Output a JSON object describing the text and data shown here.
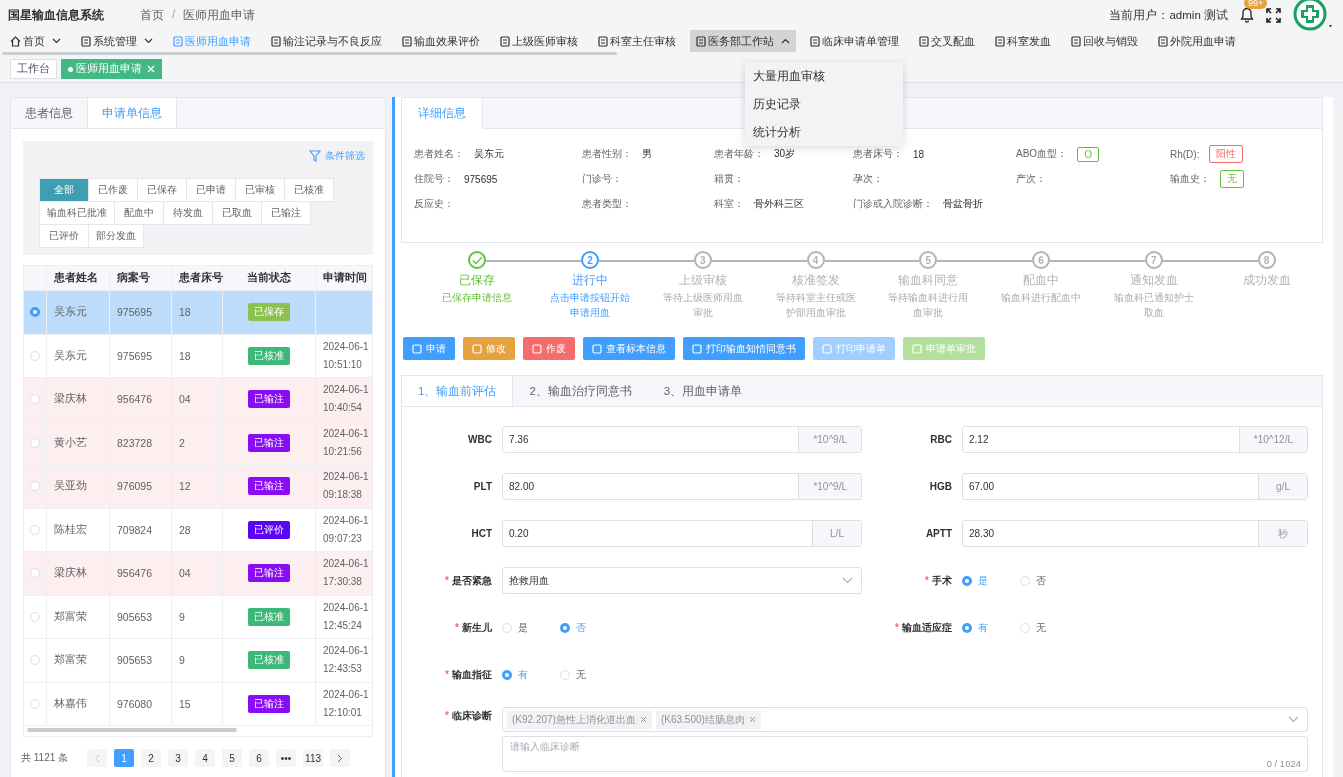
{
  "app": {
    "title": "国星输血信息系统"
  },
  "breadcrumb": {
    "items": [
      "首页",
      "医师用血申请"
    ],
    "separator": "/"
  },
  "user": {
    "label": "当前用户：admin 测试",
    "badge": "99+"
  },
  "nav": [
    {
      "label": "首页",
      "caret": true,
      "selected": false,
      "expanded": false
    },
    {
      "label": "系统管理",
      "caret": true,
      "selected": false,
      "expanded": false
    },
    {
      "label": "医师用血申请",
      "caret": false,
      "selected": true,
      "expanded": false
    },
    {
      "label": "输注记录与不良反应",
      "caret": false,
      "selected": false,
      "expanded": false
    },
    {
      "label": "输血效果评价",
      "caret": false,
      "selected": false,
      "expanded": false
    },
    {
      "label": "上级医师审核",
      "caret": false,
      "selected": false,
      "expanded": false
    },
    {
      "label": "科室主任审核",
      "caret": false,
      "selected": false,
      "expanded": false
    },
    {
      "label": "医务部工作站",
      "caret": true,
      "selected": false,
      "expanded": true
    },
    {
      "label": "临床申请单管理",
      "caret": false,
      "selected": false,
      "expanded": false
    },
    {
      "label": "交叉配血",
      "caret": false,
      "selected": false,
      "expanded": false
    },
    {
      "label": "科室发血",
      "caret": false,
      "selected": false,
      "expanded": false
    },
    {
      "label": "回收与销毁",
      "caret": false,
      "selected": false,
      "expanded": false
    },
    {
      "label": "外院用血申请",
      "caret": false,
      "selected": false,
      "expanded": false
    }
  ],
  "dropdown": [
    "大量用血审核",
    "历史记录",
    "统计分析"
  ],
  "page_tabs": [
    {
      "label": "工作台",
      "selected": false
    },
    {
      "label": "医师用血申请",
      "selected": true
    }
  ],
  "left": {
    "tabs": [
      {
        "label": "患者信息",
        "selected": false
      },
      {
        "label": "申请单信息",
        "selected": true
      }
    ],
    "filter_link": "条件筛选",
    "filters": [
      {
        "label": "全部",
        "selected": true
      },
      {
        "label": "已作废",
        "selected": false
      },
      {
        "label": "已保存",
        "selected": false
      },
      {
        "label": "已申请",
        "selected": false
      },
      {
        "label": "已审核",
        "selected": false
      },
      {
        "label": "已核准",
        "selected": false
      },
      {
        "label": "输血科已批准",
        "selected": false
      },
      {
        "label": "配血中",
        "selected": false
      },
      {
        "label": "待发血",
        "selected": false
      },
      {
        "label": "已取血",
        "selected": false
      },
      {
        "label": "已输注",
        "selected": false
      },
      {
        "label": "已评价",
        "selected": false
      },
      {
        "label": "部分发血",
        "selected": false
      }
    ],
    "columns": [
      "患者姓名",
      "病案号",
      "患者床号",
      "当前状态",
      "申请时间"
    ],
    "rows": [
      {
        "selected": true,
        "flagged": false,
        "name": "吴东元",
        "case_no": "975695",
        "bed": "18",
        "status": "已保存",
        "color": "#8cc152"
      },
      {
        "selected": false,
        "flagged": false,
        "name": "吴东元",
        "case_no": "975695",
        "bed": "18",
        "status": "已核准",
        "color": "#3cb878",
        "date": "2024-06-1",
        "time": "10:51:10"
      },
      {
        "selected": false,
        "flagged": true,
        "name": "梁庆林",
        "case_no": "956476",
        "bed": "04",
        "status": "已输注",
        "color": "#8a0cf5",
        "date": "2024-06-1",
        "time": "10:40:54"
      },
      {
        "selected": false,
        "flagged": true,
        "name": "黄小艺",
        "case_no": "823728",
        "bed": "2",
        "status": "已输注",
        "color": "#8a0cf5",
        "date": "2024-06-1",
        "time": "10:21:56"
      },
      {
        "selected": false,
        "flagged": true,
        "name": "吴亚劲",
        "case_no": "976095",
        "bed": "12",
        "status": "已输注",
        "color": "#8a0cf5",
        "date": "2024-06-1",
        "time": "09:18:38"
      },
      {
        "selected": false,
        "flagged": false,
        "name": "陈桂宏",
        "case_no": "709824",
        "bed": "28",
        "status": "已评价",
        "color": "#5a06f0",
        "date": "2024-06-1",
        "time": "09:07:23"
      },
      {
        "selected": false,
        "flagged": true,
        "name": "梁庆林",
        "case_no": "956476",
        "bed": "04",
        "status": "已输注",
        "color": "#8a0cf5",
        "date": "2024-06-1",
        "time": "17:30:38"
      },
      {
        "selected": false,
        "flagged": false,
        "name": "郑富荣",
        "case_no": "905653",
        "bed": "9",
        "status": "已核准",
        "color": "#3cb878",
        "date": "2024-06-1",
        "time": "12:45:24"
      },
      {
        "selected": false,
        "flagged": false,
        "name": "郑富荣",
        "case_no": "905653",
        "bed": "9",
        "status": "已核准",
        "color": "#3cb878",
        "date": "2024-06-1",
        "time": "12:43:53"
      },
      {
        "selected": false,
        "flagged": false,
        "name": "林嘉伟",
        "case_no": "976080",
        "bed": "15",
        "status": "已输注",
        "color": "#8a0cf5",
        "date": "2024-06-1",
        "time": "12:10:01"
      }
    ],
    "total": "共 1121 条",
    "pages": [
      {
        "label": "1",
        "selected": true
      },
      {
        "label": "2",
        "selected": false
      },
      {
        "label": "3",
        "selected": false
      },
      {
        "label": "4",
        "selected": false
      },
      {
        "label": "5",
        "selected": false
      },
      {
        "label": "6",
        "selected": false
      },
      {
        "label": "•••",
        "selected": false
      },
      {
        "label": "113",
        "selected": false
      }
    ]
  },
  "detail": {
    "tab": "详细信息",
    "fields": [
      {
        "label": "患者姓名：",
        "value": "吴东元",
        "kind": "text"
      },
      {
        "label": "患者性别：",
        "value": "男",
        "kind": "text"
      },
      {
        "label": "患者年龄：",
        "value": "30岁",
        "kind": "text"
      },
      {
        "label": "患者床号：",
        "value": "18",
        "kind": "text"
      },
      {
        "label": "ABO血型：",
        "value": "O",
        "kind": "tag",
        "color": "#67c23a"
      },
      {
        "label": "Rh(D):",
        "value": "阳性",
        "kind": "tag",
        "color": "#f56c6c"
      },
      {
        "label": "住院号：",
        "value": "975695",
        "kind": "text"
      },
      {
        "label": "门诊号："
      },
      {
        "label": "籍贯："
      },
      {
        "label": "孕次："
      },
      {
        "label": "产次："
      },
      {
        "label": "输血史：",
        "value": "无",
        "kind": "tag",
        "color": "#67c23a"
      },
      {
        "label": "反应史："
      },
      {
        "label": "患者类型："
      },
      {
        "label": "科室：",
        "value": "骨外科三区",
        "kind": "text"
      },
      {
        "label": "门诊或入院诊断：",
        "value": "骨盆骨折",
        "kind": "text"
      }
    ]
  },
  "steps": [
    {
      "done": true,
      "active": false,
      "title": "已保存",
      "desc": "已保存申请信息"
    },
    {
      "done": false,
      "active": true,
      "number": "2",
      "title": "进行中",
      "desc": "点击申请按钮开始申请用血"
    },
    {
      "done": false,
      "active": false,
      "number": "3",
      "title": "上级审核",
      "desc": "等待上级医师用血审批"
    },
    {
      "done": false,
      "active": false,
      "number": "4",
      "title": "核准签发",
      "desc": "等待科室主任或医护部用血审批"
    },
    {
      "done": false,
      "active": false,
      "number": "5",
      "title": "输血科同意",
      "desc": "等待输血科进行用血审批"
    },
    {
      "done": false,
      "active": false,
      "number": "6",
      "title": "配血中",
      "desc": "输血科进行配血中"
    },
    {
      "done": false,
      "active": false,
      "number": "7",
      "title": "通知发血",
      "desc": "输血科已通知护士取血"
    },
    {
      "done": false,
      "active": false,
      "number": "8",
      "title": "成功发血"
    }
  ],
  "actions": [
    {
      "label": "申请",
      "kind": "primary",
      "disabled": false
    },
    {
      "label": "修改",
      "kind": "warning",
      "disabled": false
    },
    {
      "label": "作废",
      "kind": "danger",
      "disabled": false
    },
    {
      "label": "查看标本信息",
      "kind": "primary",
      "disabled": false
    },
    {
      "label": "打印输血知情同意书",
      "kind": "primary",
      "disabled": false
    },
    {
      "label": "打印申请单",
      "kind": "primary",
      "disabled": true
    },
    {
      "label": "申请单审批",
      "kind": "success",
      "disabled": true
    }
  ],
  "form_tabs": [
    {
      "label": "1、输血前评估",
      "selected": true
    },
    {
      "label": "2、输血治疗同意书",
      "selected": false
    },
    {
      "label": "3、用血申请单",
      "selected": false
    }
  ],
  "form": [
    {
      "kind": "input",
      "label": "WBC",
      "value": "7.36",
      "unit": "*10^9/L"
    },
    {
      "kind": "input",
      "label": "RBC",
      "value": "2.12",
      "unit": "*10^12/L"
    },
    {
      "kind": "input",
      "label": "PLT",
      "value": "82.00",
      "unit": "*10^9/L"
    },
    {
      "kind": "input",
      "label": "HGB",
      "value": "67.00",
      "unit": "g/L"
    },
    {
      "kind": "input",
      "label": "HCT",
      "value": "0.20",
      "unit": "L/L"
    },
    {
      "kind": "input",
      "label": "APTT",
      "value": "28.30",
      "unit": "秒"
    },
    {
      "kind": "select",
      "label": "是否紧急",
      "required_mark": "*",
      "value": "抢救用血"
    },
    {
      "kind": "radio",
      "label": "手术",
      "required_mark": "*",
      "options": [
        {
          "label": "是",
          "selected": true
        },
        {
          "label": "否",
          "selected": false
        }
      ]
    },
    {
      "kind": "radio",
      "label": "新生儿",
      "required_mark": "*",
      "options": [
        {
          "label": "是",
          "selected": false
        },
        {
          "label": "否",
          "selected": true
        }
      ]
    },
    {
      "kind": "radio",
      "label": "输血适应症",
      "required_mark": "*",
      "options": [
        {
          "label": "有",
          "selected": true
        },
        {
          "label": "无",
          "selected": false
        }
      ]
    },
    {
      "kind": "radio",
      "label": "输血指征",
      "required_mark": "*",
      "options": [
        {
          "label": "有",
          "selected": true
        },
        {
          "label": "无",
          "selected": false
        }
      ]
    },
    {
      "kind": "diagnosis",
      "label": "临床诊断",
      "required_mark": "*",
      "tags": [
        "(K92.207)急性上消化道出血",
        "(K63.500)结肠息肉"
      ],
      "placeholder": "请输入临床诊断",
      "counter": "0 / 1024"
    }
  ]
}
